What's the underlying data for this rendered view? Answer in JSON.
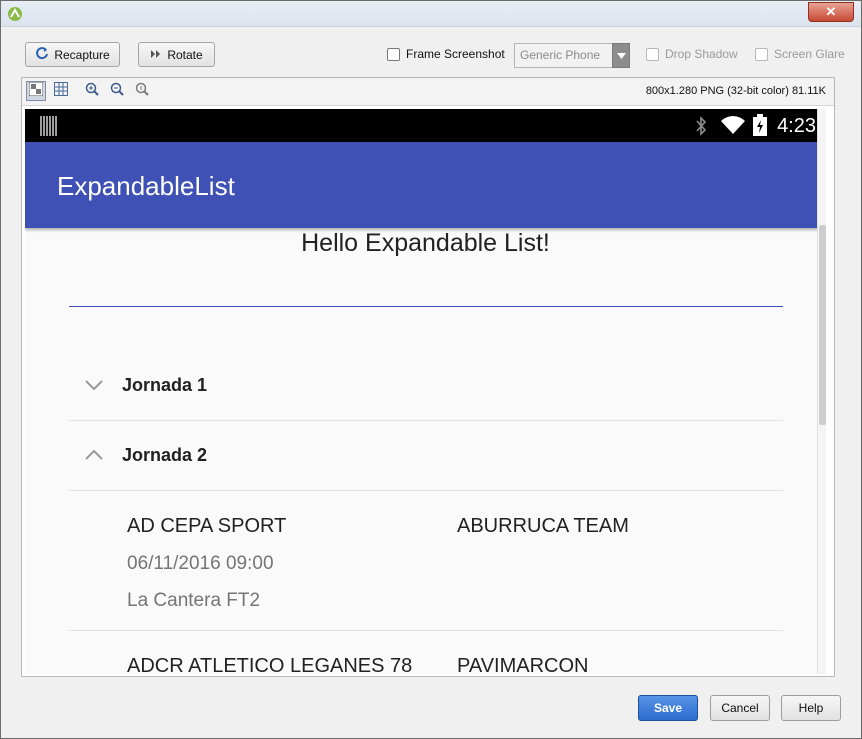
{
  "window": {
    "close_glyph": "✕"
  },
  "toolbar": {
    "recapture_label": "Recapture",
    "rotate_label": "Rotate",
    "frame_screenshot_label": "Frame Screenshot",
    "frame_screenshot_checked": false,
    "device_select_value": "Generic Phone",
    "drop_shadow_label": "Drop Shadow",
    "screen_glare_label": "Screen Glare"
  },
  "viewer": {
    "image_info": "800x1.280 PNG (32-bit color) 81.11K"
  },
  "phone": {
    "status_time": "4:23",
    "app_title": "ExpandableList",
    "heading": "Hello Expandable List!",
    "groups": [
      {
        "label": "Jornada 1",
        "expanded": false
      },
      {
        "label": "Jornada 2",
        "expanded": true
      }
    ],
    "matches": [
      {
        "home": "AD CEPA SPORT",
        "away": "ABURRUCA TEAM",
        "datetime": "06/11/2016 09:00",
        "venue": "La Cantera FT2"
      },
      {
        "home": "ADCR ATLETICO LEGANES 78",
        "away": "PAVIMARCON"
      }
    ],
    "colors": {
      "appbar": "#3f51b5",
      "statusbar": "#000000"
    }
  },
  "dialog": {
    "save_label": "Save",
    "cancel_label": "Cancel",
    "help_label": "Help"
  }
}
